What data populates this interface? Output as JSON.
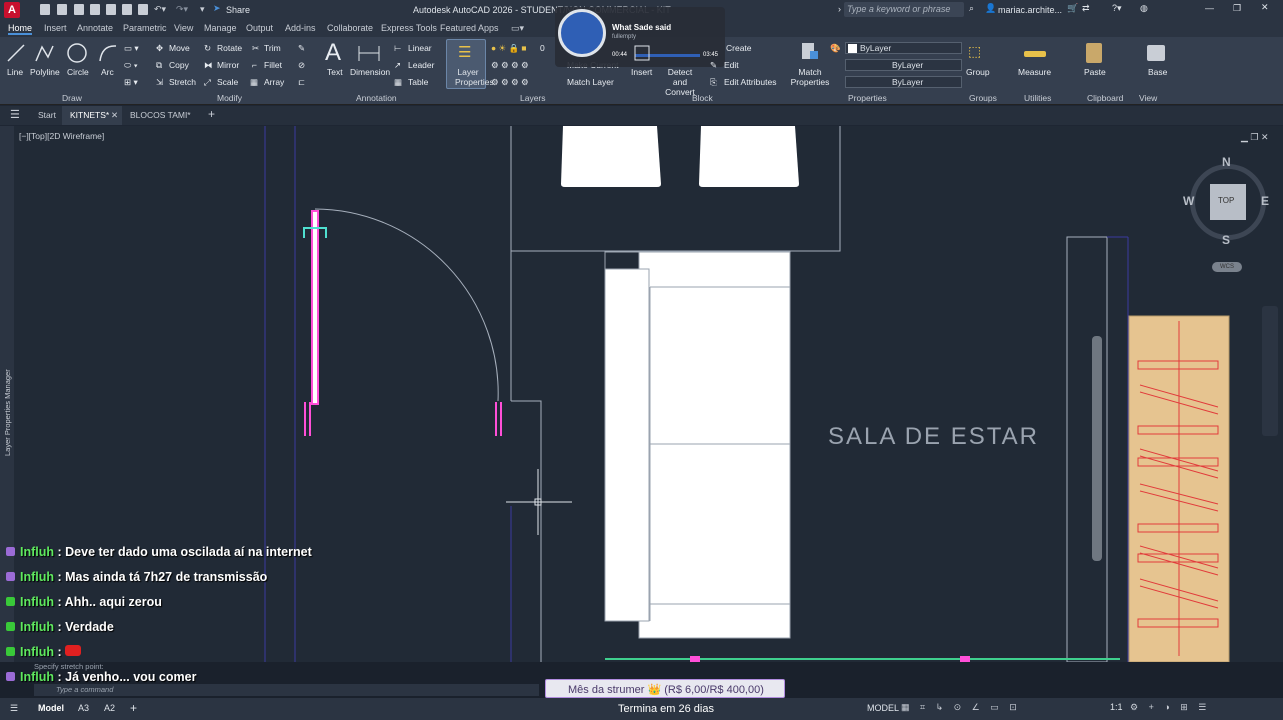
{
  "window": {
    "title": "Autodesk AutoCAD 2026 - STUDENT/NON COMMERCIAL - KITNETS.dwg",
    "share_label": "Share",
    "search_placeholder": "Type a keyword or phrase",
    "user": "mariac.archite..."
  },
  "ribbon_tabs": [
    "Home",
    "Insert",
    "Annotate",
    "Parametric",
    "View",
    "Manage",
    "Output",
    "Add-ins",
    "Collaborate",
    "Express Tools",
    "Featured Apps"
  ],
  "draw": {
    "title": "Draw",
    "line": "Line",
    "polyline": "Polyline",
    "circle": "Circle",
    "arc": "Arc"
  },
  "modify": {
    "title": "Modify",
    "move": "Move",
    "rotate": "Rotate",
    "trim": "Trim",
    "copy": "Copy",
    "mirror": "Mirror",
    "fillet": "Fillet",
    "stretch": "Stretch",
    "scale": "Scale",
    "array": "Array"
  },
  "annotation": {
    "title": "Annotation",
    "text": "Text",
    "dimension": "Dimension",
    "linear": "Linear",
    "leader": "Leader",
    "table": "Table"
  },
  "layers": {
    "title": "Layers",
    "layer_properties": "Layer Properties",
    "make_current": "Make Current",
    "match_layer": "Match Layer",
    "current": "0"
  },
  "block": {
    "title": "Block",
    "insert": "Insert",
    "detect": "Detect and Convert",
    "create": "Create",
    "edit": "Edit",
    "edit_attributes": "Edit Attributes"
  },
  "properties": {
    "title": "Properties",
    "match": "Match Properties",
    "bylayer1": "ByLayer",
    "bylayer2": "ByLayer",
    "bylayer3": "ByLayer"
  },
  "groups": {
    "title": "Groups",
    "group": "Group"
  },
  "utilities": {
    "title": "Utilities",
    "measure": "Measure"
  },
  "clipboard": {
    "title": "Clipboard",
    "paste": "Paste"
  },
  "view_panel": {
    "title": "View",
    "base": "Base"
  },
  "doc_tabs": {
    "start": "Start",
    "kitnets": "KITNETS*",
    "blocos": "BLOCOS TAMI*"
  },
  "viewport": {
    "label": "[−][Top][2D Wireframe]",
    "room_label": "SALA DE ESTAR",
    "side_palette": "Layer Properties Manager"
  },
  "viewcube": {
    "n": "N",
    "s": "S",
    "e": "E",
    "w": "W",
    "top": "TOP",
    "wcs": "WCS"
  },
  "music": {
    "title": "What Sade said",
    "artist": "fullempty",
    "elapsed": "00:44",
    "total": "03:45"
  },
  "chat": [
    {
      "user": "Influh",
      "msg": ": Deve ter dado uma oscilada aí na internet",
      "badge": "p"
    },
    {
      "user": "Influh",
      "msg": ": Mas ainda tá 7h27 de transmissão",
      "badge": "p"
    },
    {
      "user": "Influh",
      "msg": ": Ahh.. aqui zerou",
      "badge": "k"
    },
    {
      "user": "Influh",
      "msg": ": Verdade",
      "badge": "k"
    },
    {
      "user": "Influh",
      "msg": ":",
      "badge": "k"
    },
    {
      "user": "Influh",
      "msg": ": Já venho... vou comer",
      "badge": "p"
    }
  ],
  "command": {
    "placeholder": "Type a command",
    "history": "Specify stretch point:"
  },
  "overlay": {
    "goal": "Mês da strumer 👑 (R$ 6,00/R$ 400,00)",
    "ends": "Termina em 26 dias"
  },
  "status": {
    "model_tab": "Model",
    "a3": "A3",
    "a2": "A2",
    "model": "MODEL",
    "scale": "1:1"
  }
}
